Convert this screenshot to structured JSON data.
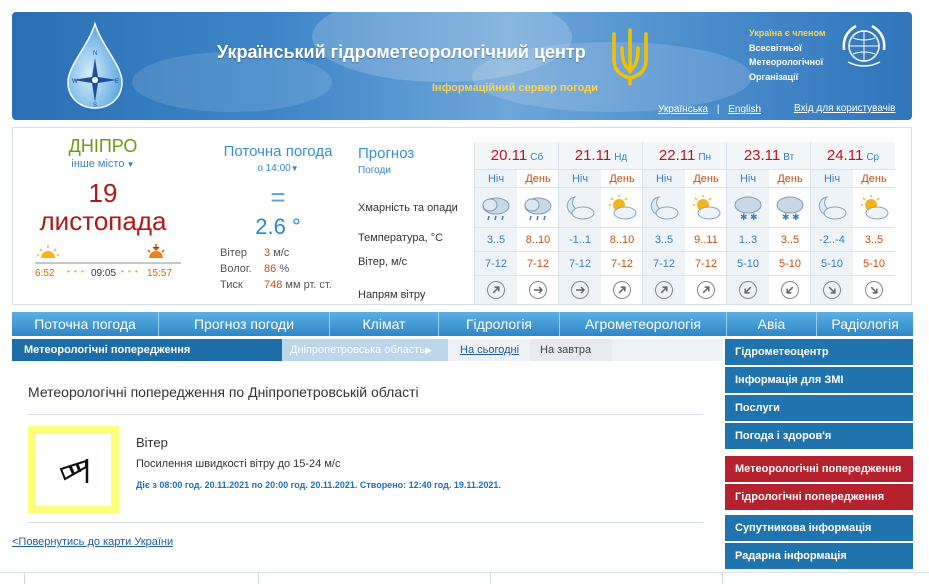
{
  "header": {
    "title": "Український гідрометеорологічний центр",
    "subtitle": "Інформаційний сервер погоди",
    "wmo_lines": [
      "Україна є членом",
      "Всесвітньої",
      "Метеорологічної",
      "Організації"
    ],
    "lang_ua": "Українська",
    "lang_sep": "|",
    "lang_en": "English",
    "login": "Вхід для користувачів"
  },
  "city": {
    "name": "ДНІПРО",
    "other": "інше місто",
    "day": "19",
    "month": "листопада",
    "sunrise": "6:52",
    "daylength": "09:05",
    "sunset": "15:57"
  },
  "current": {
    "title": "Поточна погода",
    "time": "о 14:00",
    "symbol": "=",
    "temp": "2.6 °",
    "wind_label": "Вітер",
    "wind_value": "3",
    "wind_unit": "м/с",
    "hum_label": "Волог.",
    "hum_value": "86",
    "hum_unit": "%",
    "press_label": "Тиск",
    "press_value": "748",
    "press_unit": "мм рт. ст."
  },
  "forecast": {
    "title": "Прогноз",
    "subtitle": "Погоди",
    "label_clouds": "Хмарність та опади",
    "label_temp": "Температура, °C",
    "label_wind": "Вітер, м/с",
    "label_dir": "Напрям вітру",
    "night_label": "Ніч",
    "day_label": "День",
    "days": [
      {
        "date": "20.11",
        "wd": "Сб",
        "temp_n": "3..5",
        "temp_d": "8..10",
        "wind_n": "7-12",
        "wind_d": "7-12",
        "icon_n": "cloud-rain-icon",
        "icon_d": "cloud-rain-icon",
        "dir_n": 45,
        "dir_d": 90
      },
      {
        "date": "21.11",
        "wd": "Нд",
        "temp_n": "-1..1",
        "temp_d": "8..10",
        "wind_n": "7-12",
        "wind_d": "7-12",
        "icon_n": "moon-cloud-icon",
        "icon_d": "sun-cloud-icon",
        "dir_n": 90,
        "dir_d": 45
      },
      {
        "date": "22.11",
        "wd": "Пн",
        "temp_n": "3..5",
        "temp_d": "9..11",
        "wind_n": "7-12",
        "wind_d": "7-12",
        "icon_n": "moon-cloud-icon",
        "icon_d": "sun-cloud-icon",
        "dir_n": 45,
        "dir_d": 45
      },
      {
        "date": "23.11",
        "wd": "Вт",
        "temp_n": "1..3",
        "temp_d": "3..5",
        "wind_n": "5-10",
        "wind_d": "5-10",
        "icon_n": "cloud-snow-icon",
        "icon_d": "cloud-snow-icon",
        "dir_n": 225,
        "dir_d": 225
      },
      {
        "date": "24.11",
        "wd": "Ср",
        "temp_n": "-2..-4",
        "temp_d": "3..5",
        "wind_n": "5-10",
        "wind_d": "5-10",
        "icon_n": "moon-cloud-icon",
        "icon_d": "sun-cloud-icon",
        "dir_n": 135,
        "dir_d": 135
      }
    ]
  },
  "nav": {
    "items": [
      "Поточна погода",
      "Прогноз погоди",
      "Клімат",
      "Гідрологія",
      "Агрометеорологія",
      "Авіа",
      "Радіологія"
    ]
  },
  "subnav": {
    "active": "Метеорологічні попередження",
    "region": "Дніпропетровська область",
    "today": "На сьогодні",
    "tomorrow": "На завтра"
  },
  "content": {
    "title": "Метеорологічні попередження по Дніпропетровській області",
    "warning_type": "Вітер",
    "warning_desc": "Посилення швидкості вітру до 15-24 м/с",
    "warning_meta": "Діє з 08:00 год. 20.11.2021 по 20:00 год. 20.11.2021. Створено: 12:40 год. 19.11.2021.",
    "warning_icon": "windsock-icon",
    "warning_color": "#ffff7a",
    "back_link": "<Повернутись до карти України"
  },
  "sidebar": {
    "items": [
      {
        "label": "Гідрометеоцентр",
        "color": "blue"
      },
      {
        "label": "Інформація для ЗМІ",
        "color": "blue"
      },
      {
        "label": "Послуги",
        "color": "blue"
      },
      {
        "label": "Погода і здоров'я",
        "color": "blue"
      },
      {
        "label": "Метеорологічні попередження",
        "color": "red"
      },
      {
        "label": "Гідрологічні попередження",
        "color": "red"
      },
      {
        "label": "Супутникова інформація",
        "color": "blue"
      },
      {
        "label": "Радарна інформація",
        "color": "blue"
      }
    ]
  }
}
